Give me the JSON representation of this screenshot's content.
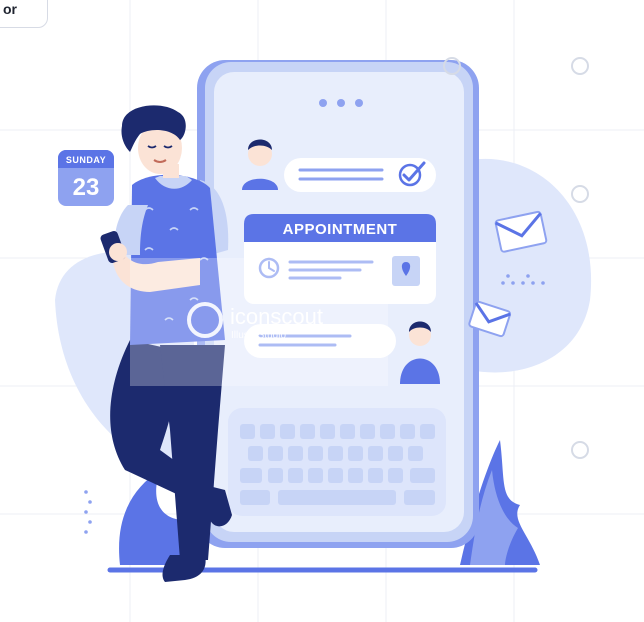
{
  "corner_tag": {
    "text": "or"
  },
  "calendar": {
    "month": "SUNDAY",
    "day": "23"
  },
  "appointment": {
    "title": "APPOINTMENT"
  },
  "watermark": {
    "brand": "iconscout",
    "sub": "Illustr Studio"
  },
  "colors": {
    "primary": "#5b74e6",
    "primary_dark": "#1c2a6e",
    "light": "#e8eefc",
    "mid": "#c7d4f6",
    "background_blob": "#dfe7fb",
    "skin": "#fbe3d6"
  }
}
